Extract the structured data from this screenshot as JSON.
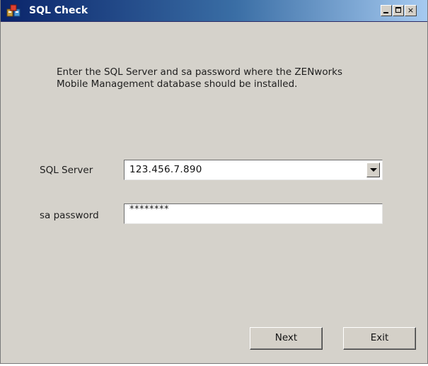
{
  "window": {
    "title": "SQL Check",
    "icon": "sql-check-app-icon",
    "controls": {
      "minimize": "minimize",
      "maximize": "maximize",
      "close": "×"
    }
  },
  "intro": {
    "line1": "Enter the SQL Server and sa password where the ZENworks",
    "line2": "Mobile Management database should be installed."
  },
  "form": {
    "server_label": "SQL Server",
    "server_value": "123.456.7.890",
    "password_label": "sa password",
    "password_value": "********"
  },
  "buttons": {
    "next": "Next",
    "exit": "Exit"
  }
}
